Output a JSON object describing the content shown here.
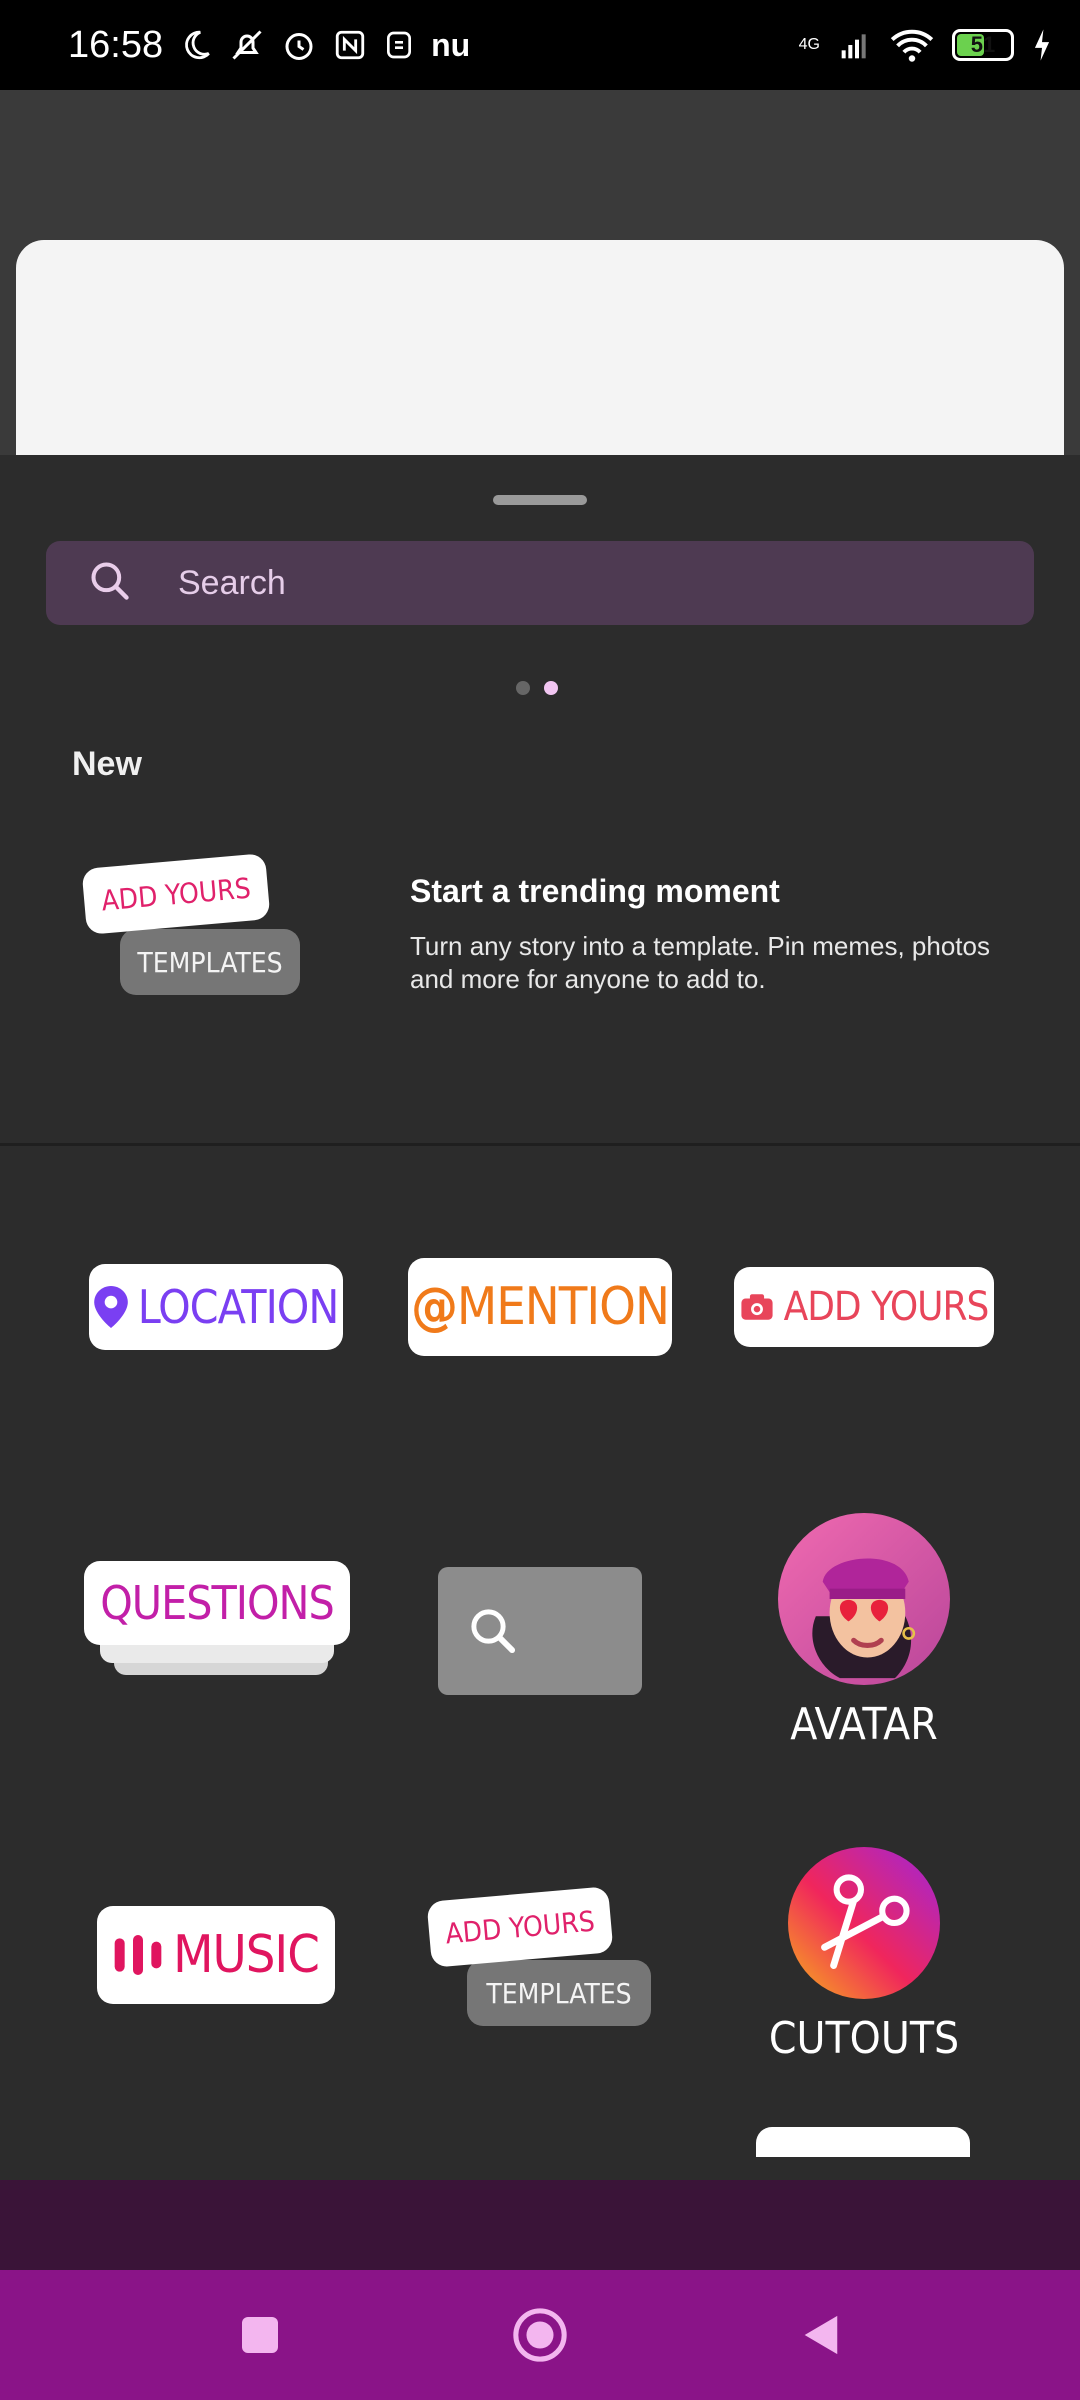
{
  "status_bar": {
    "time": "16:58",
    "battery_level": "51",
    "network": "4G",
    "icons": [
      "moon-icon",
      "bell-off-icon",
      "alarm-icon",
      "nfc-icon",
      "sim-icon",
      "nu-icon",
      "signal-icon",
      "wifi-icon",
      "battery-icon",
      "charging-icon"
    ],
    "nu_label": "nu"
  },
  "search": {
    "placeholder": "Search"
  },
  "pager": {
    "pages": 2,
    "active_index": 1
  },
  "section": {
    "title": "New"
  },
  "featured": {
    "pill_top": "ADD YOURS",
    "pill_bottom": "TEMPLATES",
    "title": "Start a trending moment",
    "description": "Turn any story into a template. Pin memes, photos and more for anyone to add to."
  },
  "stickers": {
    "location": "LOCATION",
    "mention": "MENTION",
    "mention_prefix": "@",
    "add_yours": "ADD YOURS",
    "questions": "QUESTIONS",
    "avatar": "AVATAR",
    "music": "MUSIC",
    "templates_top": "ADD YOURS",
    "templates_bottom": "TEMPLATES",
    "cutouts": "CUTOUTS"
  },
  "colors": {
    "location": "#7a3ff2",
    "mention": "#f07a1a",
    "add_yours": "#e8455a",
    "questions": "#c21fa8",
    "music": "#e0155f",
    "nav_bar": "#8a1488"
  }
}
